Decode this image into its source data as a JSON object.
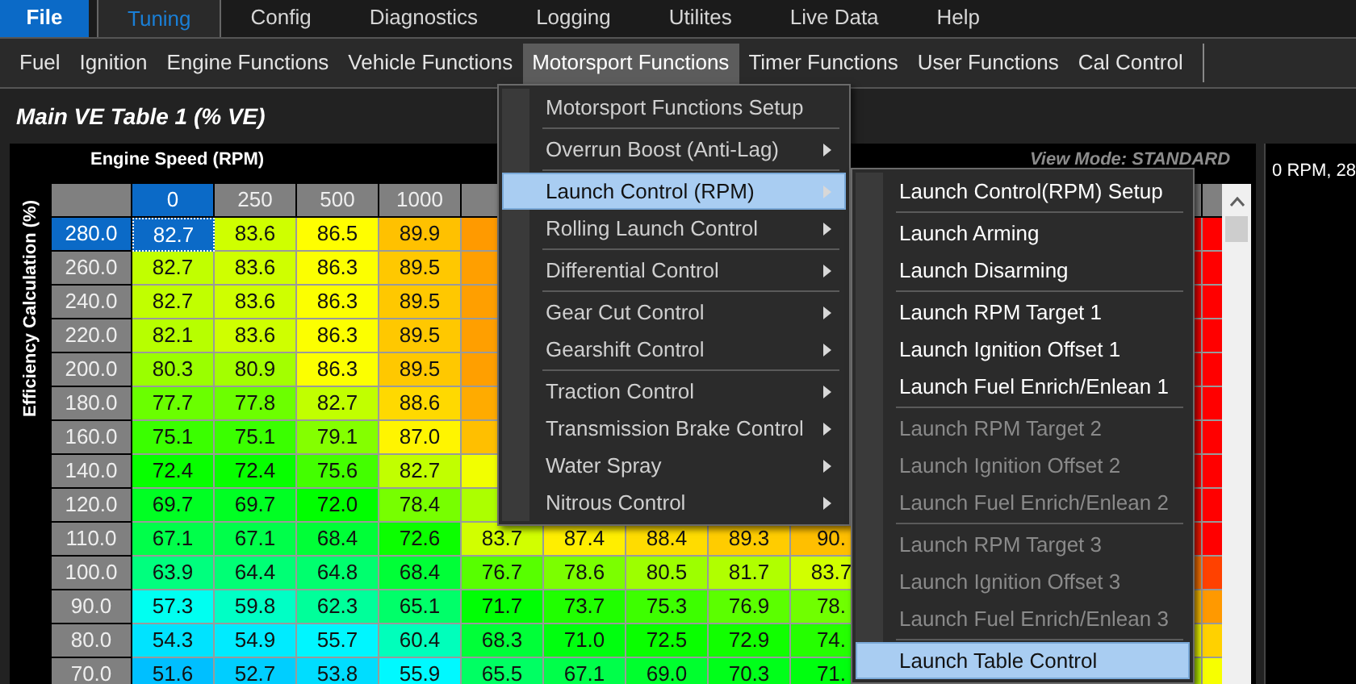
{
  "menu_bar": {
    "file_button": "File",
    "tabs": [
      {
        "label": "Tuning",
        "selected": true
      },
      {
        "label": "Config",
        "selected": false
      },
      {
        "label": "Diagnostics",
        "selected": false
      },
      {
        "label": "Logging",
        "selected": false
      },
      {
        "label": "Utilites",
        "selected": false
      },
      {
        "label": "Live Data",
        "selected": false
      },
      {
        "label": "Help",
        "selected": false
      }
    ]
  },
  "toolbar": {
    "items": [
      {
        "label": "Fuel",
        "selected": false
      },
      {
        "label": "Ignition",
        "selected": false
      },
      {
        "label": "Engine Functions",
        "selected": false
      },
      {
        "label": "Vehicle Functions",
        "selected": false
      },
      {
        "label": "Motorsport Functions",
        "selected": true
      },
      {
        "label": "Timer Functions",
        "selected": false
      },
      {
        "label": "User Functions",
        "selected": false
      },
      {
        "label": "Cal Control",
        "selected": false
      }
    ]
  },
  "title": "Main VE Table 1 (% VE)",
  "table": {
    "x_axis_title": "Engine Speed (RPM)",
    "y_axis_title": "Efficiency Calculation (%)",
    "view_mode": "View Mode: STANDARD",
    "columns": [
      {
        "label": "0",
        "selected": true
      },
      {
        "label": "250",
        "selected": false
      },
      {
        "label": "500",
        "selected": false
      },
      {
        "label": "1000",
        "selected": false
      }
    ],
    "rows": [
      {
        "label": "280.0",
        "selected": true,
        "cells": [
          "82.7",
          "83.6",
          "86.5",
          "89.9"
        ]
      },
      {
        "label": "260.0",
        "selected": false,
        "cells": [
          "82.7",
          "83.6",
          "86.3",
          "89.5"
        ]
      },
      {
        "label": "240.0",
        "selected": false,
        "cells": [
          "82.7",
          "83.6",
          "86.3",
          "89.5"
        ]
      },
      {
        "label": "220.0",
        "selected": false,
        "cells": [
          "82.1",
          "83.6",
          "86.3",
          "89.5"
        ]
      },
      {
        "label": "200.0",
        "selected": false,
        "cells": [
          "80.3",
          "80.9",
          "86.3",
          "89.5"
        ]
      },
      {
        "label": "180.0",
        "selected": false,
        "cells": [
          "77.7",
          "77.8",
          "82.7",
          "88.6"
        ]
      },
      {
        "label": "160.0",
        "selected": false,
        "cells": [
          "75.1",
          "75.1",
          "79.1",
          "87.0"
        ]
      },
      {
        "label": "140.0",
        "selected": false,
        "cells": [
          "72.4",
          "72.4",
          "75.6",
          "82.7"
        ]
      },
      {
        "label": "120.0",
        "selected": false,
        "cells": [
          "69.7",
          "69.7",
          "72.0",
          "78.4"
        ]
      },
      {
        "label": "110.0",
        "selected": false,
        "cells": [
          "67.1",
          "67.1",
          "68.4",
          "72.6",
          "83.7",
          "87.4",
          "88.4",
          "89.3",
          "90."
        ]
      },
      {
        "label": "100.0",
        "selected": false,
        "cells": [
          "63.9",
          "64.4",
          "64.8",
          "68.4",
          "76.7",
          "78.6",
          "80.5",
          "81.7",
          "83.7"
        ]
      },
      {
        "label": "90.0",
        "selected": false,
        "cells": [
          "57.3",
          "59.8",
          "62.3",
          "65.1",
          "71.7",
          "73.7",
          "75.3",
          "76.9",
          "78."
        ]
      },
      {
        "label": "80.0",
        "selected": false,
        "cells": [
          "54.3",
          "54.9",
          "55.7",
          "60.4",
          "68.3",
          "71.0",
          "72.5",
          "72.9",
          "74."
        ]
      },
      {
        "label": "70.0",
        "selected": false,
        "cells": [
          "51.6",
          "52.7",
          "53.8",
          "55.9",
          "65.5",
          "67.1",
          "69.0",
          "70.3",
          "71."
        ]
      }
    ]
  },
  "side_panel": {
    "text": "0 RPM, 28"
  },
  "menu": {
    "groups": [
      [
        {
          "label": "Motorsport Functions Setup",
          "selected": false,
          "has_submenu": false
        }
      ],
      [
        {
          "label": "Overrun Boost (Anti-Lag)",
          "selected": false,
          "has_submenu": true
        }
      ],
      [
        {
          "label": "Launch Control (RPM)",
          "selected": true,
          "has_submenu": true
        },
        {
          "label": "Rolling Launch Control",
          "selected": false,
          "has_submenu": true
        }
      ],
      [
        {
          "label": "Differential Control",
          "selected": false,
          "has_submenu": true
        }
      ],
      [
        {
          "label": "Gear Cut Control",
          "selected": false,
          "has_submenu": true
        },
        {
          "label": "Gearshift Control",
          "selected": false,
          "has_submenu": true
        }
      ],
      [
        {
          "label": "Traction Control",
          "selected": false,
          "has_submenu": true
        },
        {
          "label": "Transmission Brake Control",
          "selected": false,
          "has_submenu": true
        },
        {
          "label": "Water Spray",
          "selected": false,
          "has_submenu": true
        },
        {
          "label": "Nitrous Control",
          "selected": false,
          "has_submenu": true
        }
      ]
    ]
  },
  "submenu": {
    "groups": [
      [
        {
          "label": "Launch Control(RPM) Setup",
          "selected": false,
          "disabled": false
        }
      ],
      [
        {
          "label": "Launch Arming",
          "selected": false,
          "disabled": false
        },
        {
          "label": "Launch Disarming",
          "selected": false,
          "disabled": false
        }
      ],
      [
        {
          "label": "Launch RPM Target 1",
          "selected": false,
          "disabled": false
        },
        {
          "label": "Launch Ignition Offset 1",
          "selected": false,
          "disabled": false
        },
        {
          "label": "Launch Fuel Enrich/Enlean 1",
          "selected": false,
          "disabled": false
        }
      ],
      [
        {
          "label": "Launch RPM Target 2",
          "selected": false,
          "disabled": true
        },
        {
          "label": "Launch Ignition Offset 2",
          "selected": false,
          "disabled": true
        },
        {
          "label": "Launch Fuel Enrich/Enlean 2",
          "selected": false,
          "disabled": true
        }
      ],
      [
        {
          "label": "Launch RPM Target 3",
          "selected": false,
          "disabled": true
        },
        {
          "label": "Launch Ignition Offset 3",
          "selected": false,
          "disabled": true
        },
        {
          "label": "Launch Fuel Enrich/Enlean 3",
          "selected": false,
          "disabled": true
        }
      ],
      [
        {
          "label": "Launch Table Control",
          "selected": true,
          "disabled": false
        }
      ]
    ]
  }
}
